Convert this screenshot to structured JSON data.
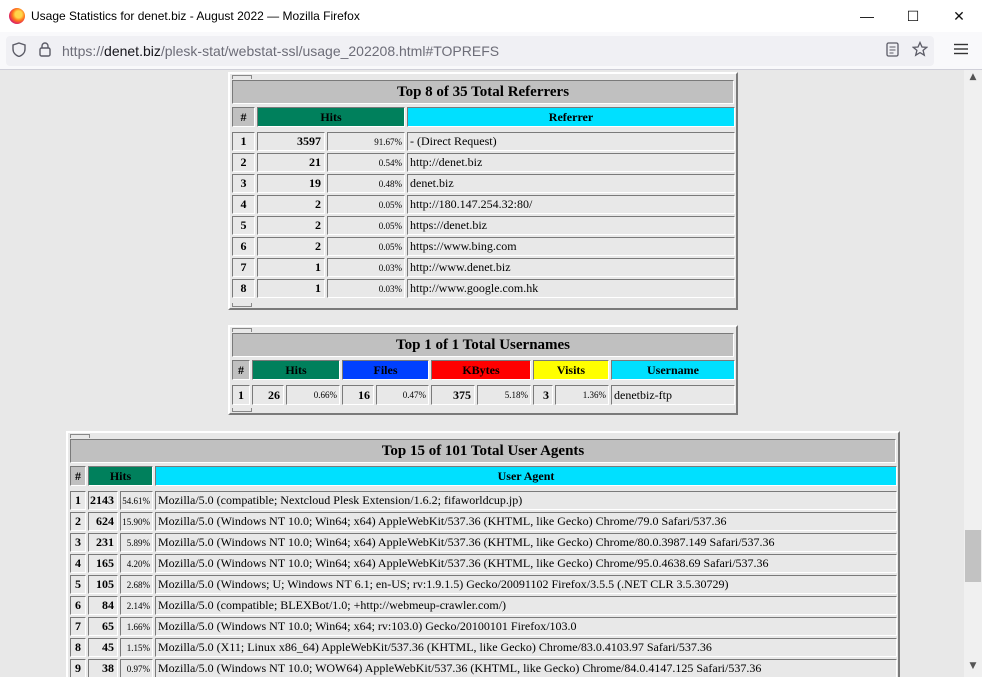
{
  "window": {
    "title": "Usage Statistics for denet.biz - August 2022 — Mozilla Firefox",
    "minimize": "—",
    "maximize": "☐",
    "close": "✕"
  },
  "urlbar": {
    "prefix": "https://",
    "host": "denet.biz",
    "path": "/plesk-stat/webstat-ssl/usage_202208.html#TOPREFS"
  },
  "referrers": {
    "title": "Top 8 of 35 Total Referrers",
    "headers": {
      "num": "#",
      "hits": "Hits",
      "referrer": "Referrer"
    },
    "rows": [
      {
        "n": "1",
        "hits": "3597",
        "pct": "91.67%",
        "ref": "- (Direct Request)"
      },
      {
        "n": "2",
        "hits": "21",
        "pct": "0.54%",
        "ref": "http://denet.biz"
      },
      {
        "n": "3",
        "hits": "19",
        "pct": "0.48%",
        "ref": "denet.biz"
      },
      {
        "n": "4",
        "hits": "2",
        "pct": "0.05%",
        "ref": "http://180.147.254.32:80/"
      },
      {
        "n": "5",
        "hits": "2",
        "pct": "0.05%",
        "ref": "https://denet.biz"
      },
      {
        "n": "6",
        "hits": "2",
        "pct": "0.05%",
        "ref": "https://www.bing.com"
      },
      {
        "n": "7",
        "hits": "1",
        "pct": "0.03%",
        "ref": "http://www.denet.biz"
      },
      {
        "n": "8",
        "hits": "1",
        "pct": "0.03%",
        "ref": "http://www.google.com.hk"
      }
    ]
  },
  "usernames": {
    "title": "Top 1 of 1 Total Usernames",
    "headers": {
      "num": "#",
      "hits": "Hits",
      "files": "Files",
      "kbytes": "KBytes",
      "visits": "Visits",
      "username": "Username"
    },
    "rows": [
      {
        "n": "1",
        "hits": "26",
        "hits_pct": "0.66%",
        "files": "16",
        "files_pct": "0.47%",
        "kb": "375",
        "kb_pct": "5.18%",
        "visits": "3",
        "visits_pct": "1.36%",
        "user": "denetbiz-ftp"
      }
    ]
  },
  "agents": {
    "title": "Top 15 of 101 Total User Agents",
    "headers": {
      "num": "#",
      "hits": "Hits",
      "agent": "User Agent"
    },
    "rows": [
      {
        "n": "1",
        "hits": "2143",
        "pct": "54.61%",
        "ua": "Mozilla/5.0 (compatible; Nextcloud Plesk Extension/1.6.2; fifaworldcup.jp)"
      },
      {
        "n": "2",
        "hits": "624",
        "pct": "15.90%",
        "ua": "Mozilla/5.0 (Windows NT 10.0; Win64; x64) AppleWebKit/537.36 (KHTML, like Gecko) Chrome/79.0 Safari/537.36"
      },
      {
        "n": "3",
        "hits": "231",
        "pct": "5.89%",
        "ua": "Mozilla/5.0 (Windows NT 10.0; Win64; x64) AppleWebKit/537.36 (KHTML, like Gecko) Chrome/80.0.3987.149 Safari/537.36"
      },
      {
        "n": "4",
        "hits": "165",
        "pct": "4.20%",
        "ua": "Mozilla/5.0 (Windows NT 10.0; Win64; x64) AppleWebKit/537.36 (KHTML, like Gecko) Chrome/95.0.4638.69 Safari/537.36"
      },
      {
        "n": "5",
        "hits": "105",
        "pct": "2.68%",
        "ua": "Mozilla/5.0 (Windows; U; Windows NT 6.1; en-US; rv:1.9.1.5) Gecko/20091102 Firefox/3.5.5 (.NET CLR 3.5.30729)"
      },
      {
        "n": "6",
        "hits": "84",
        "pct": "2.14%",
        "ua": "Mozilla/5.0 (compatible; BLEXBot/1.0; +http://webmeup-crawler.com/)"
      },
      {
        "n": "7",
        "hits": "65",
        "pct": "1.66%",
        "ua": "Mozilla/5.0 (Windows NT 10.0; Win64; x64; rv:103.0) Gecko/20100101 Firefox/103.0"
      },
      {
        "n": "8",
        "hits": "45",
        "pct": "1.15%",
        "ua": "Mozilla/5.0 (X11; Linux x86_64) AppleWebKit/537.36 (KHTML, like Gecko) Chrome/83.0.4103.97 Safari/537.36"
      },
      {
        "n": "9",
        "hits": "38",
        "pct": "0.97%",
        "ua": "Mozilla/5.0 (Windows NT 10.0; WOW64) AppleWebKit/537.36 (KHTML, like Gecko) Chrome/84.0.4147.125 Safari/537.36"
      }
    ]
  }
}
